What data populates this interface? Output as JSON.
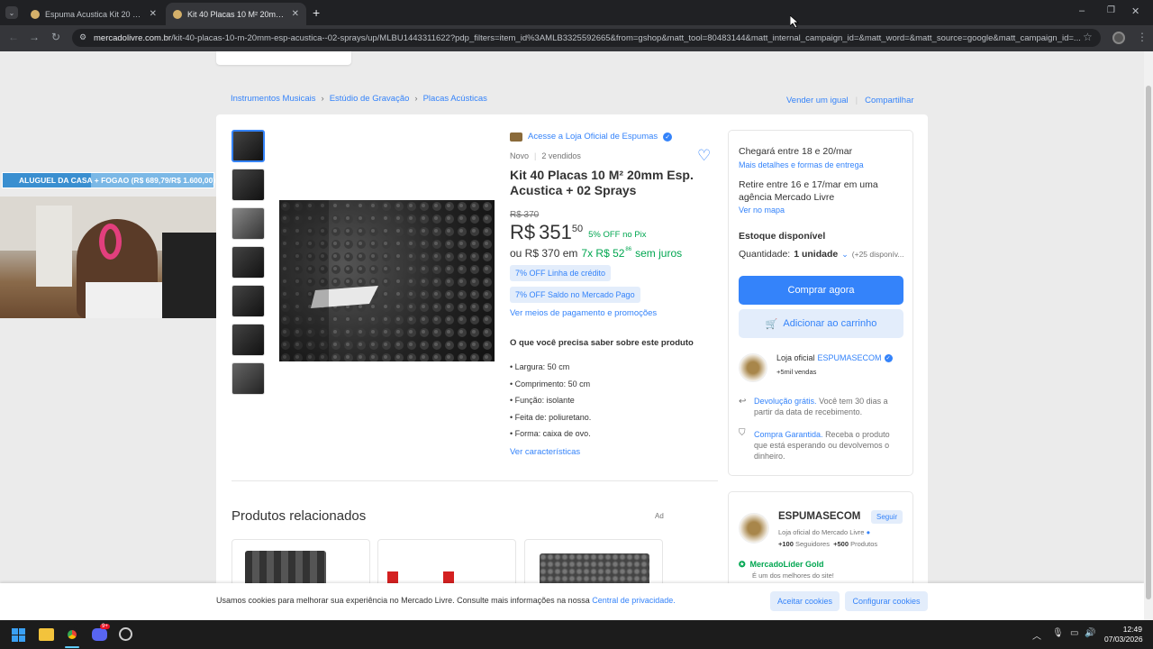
{
  "browser": {
    "tabs": [
      {
        "title": "Espuma Acustica Kit 20 Placas"
      },
      {
        "title": "Kit 40 Placas 10 M² 20mm Esp."
      }
    ],
    "url_domain": "mercadolivre.com.br",
    "url_path": "/kit-40-placas-10-m-20mm-esp-acustica--02-sprays/up/MLBU1443311622?pdp_filters=item_id%3AMLB3325592665&from=gshop&matt_tool=80483144&matt_internal_campaign_id=&matt_word=&matt_source=google&matt_campaign_id=..."
  },
  "breadcrumb": [
    "Instrumentos Musicais",
    "Estúdio de Gravação",
    "Placas Acústicas"
  ],
  "header_links": {
    "sell": "Vender um igual",
    "share": "Compartilhar"
  },
  "product": {
    "store_link": "Acesse a Loja Oficial de Espumas",
    "condition": "Novo",
    "sold": "2 vendidos",
    "title": "Kit 40 Placas 10 M² 20mm Esp. Acustica + 02 Sprays",
    "old_price": "R$ 370",
    "currency": "R$",
    "price_int": "351",
    "price_cents": "50",
    "pix_discount": "5% OFF no Pix",
    "installment_prefix": "ou R$ 370 em",
    "installments": "7x R$ 52",
    "installment_cents": "86",
    "installment_suffix": "sem juros",
    "promo1": "7% OFF Linha de crédito",
    "promo2": "7% OFF Saldo no Mercado Pago",
    "payment_link": "Ver meios de pagamento e promoções",
    "features_title": "O que você precisa saber sobre este produto",
    "features": [
      "Largura: 50 cm",
      "Comprimento: 50 cm",
      "Função: isolante",
      "Feita de: poliuretano.",
      "Forma: caixa de ovo."
    ],
    "features_link": "Ver características"
  },
  "buybox": {
    "delivery": "Chegará entre 18 e 20/mar",
    "delivery_link": "Mais detalhes e formas de entrega",
    "pickup": "Retire entre 16 e 17/mar em uma agência Mercado Livre",
    "map_link": "Ver no mapa",
    "stock": "Estoque disponível",
    "qty_label": "Quantidade:",
    "qty_value": "1 unidade",
    "qty_available": "(+25 disponív...",
    "buy_now": "Comprar agora",
    "add_cart": "Adicionar ao carrinho",
    "seller_prefix": "Loja oficial",
    "seller_name": "ESPUMASECOM",
    "seller_sales": "+5mil vendas",
    "return_link": "Devolução grátis.",
    "return_text": "Você tem 30 dias a partir da data de recebimento.",
    "guarantee_link": "Compra Garantida.",
    "guarantee_text": "Receba o produto que está esperando ou devolvemos o dinheiro."
  },
  "seller_card": {
    "name": "ESPUMASECOM",
    "follow": "Seguir",
    "subtitle": "Loja oficial do Mercado Livre",
    "followers_num": "+100",
    "followers_label": "Seguidores",
    "products_num": "+500",
    "products_label": "Produtos",
    "badge": "MercadoLíder Gold",
    "badge_sub": "É um dos melhores do site!"
  },
  "related": {
    "title": "Produtos relacionados",
    "ad": "Ad"
  },
  "cookie": {
    "text": "Usamos cookies para melhorar sua experiência no Mercado Livre. Consulte mais informações na nossa",
    "link": "Central de privacidade.",
    "accept": "Aceitar cookies",
    "configure": "Configurar cookies"
  },
  "overlay": {
    "banner": "ALUGUEL DA CASA + FOGAO (R$ 689,79/R$ 1.600,00)"
  },
  "taskbar": {
    "time": "12:49",
    "date": "07/03/2026",
    "discord_badge": "9+"
  },
  "colors": {
    "accent": "#3483fa",
    "green": "#00a650",
    "taskbar": "#1c1c1c"
  }
}
